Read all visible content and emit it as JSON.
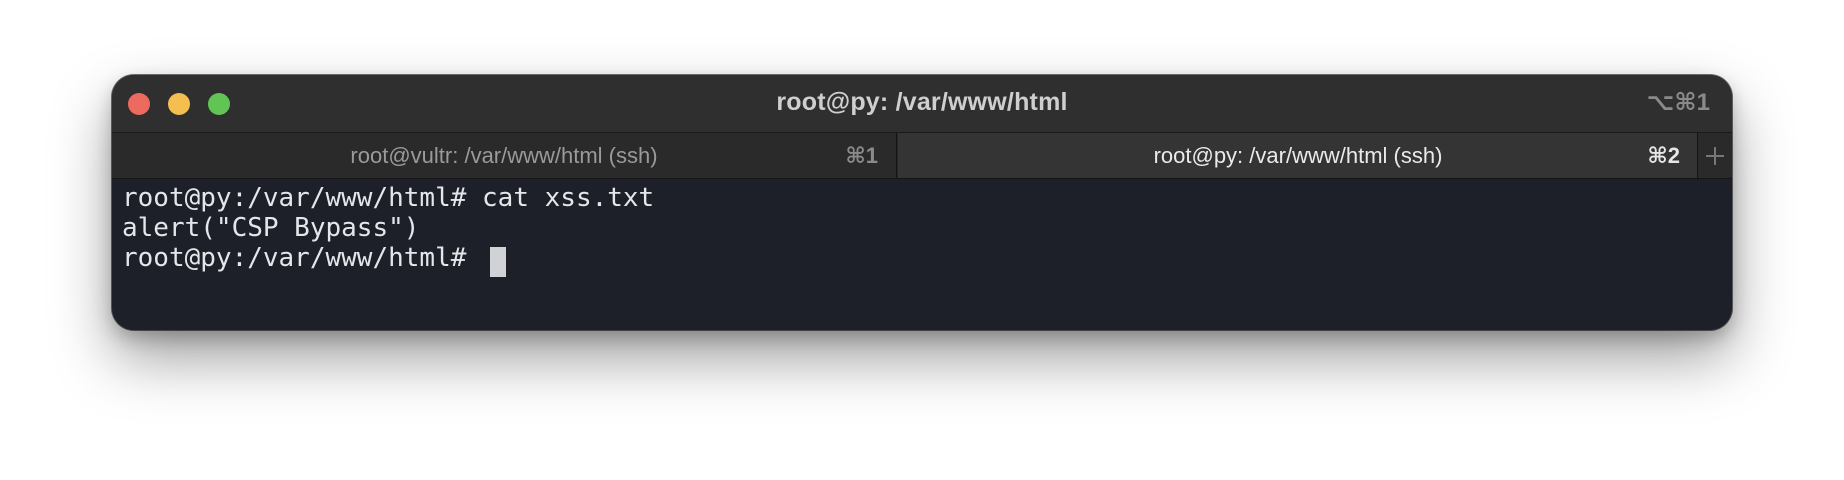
{
  "window": {
    "title": "root@py: /var/www/html",
    "title_shortcut": "⌥⌘1"
  },
  "tabs": [
    {
      "label": "root@vultr: /var/www/html (ssh)",
      "shortcut": "⌘1",
      "active": false
    },
    {
      "label": "root@py: /var/www/html (ssh)",
      "shortcut": "⌘2",
      "active": true
    }
  ],
  "terminal": {
    "lines": [
      "root@py:/var/www/html# cat xss.txt",
      "alert(\"CSP Bypass\")",
      "root@py:/var/www/html# "
    ]
  },
  "colors": {
    "close": "#ed6a5e",
    "minimize": "#f5bf4f",
    "zoom": "#61c554",
    "terminal_bg": "#1d2029",
    "terminal_fg": "#e4e6ea"
  },
  "icons": {
    "new_tab": "plus-icon"
  }
}
